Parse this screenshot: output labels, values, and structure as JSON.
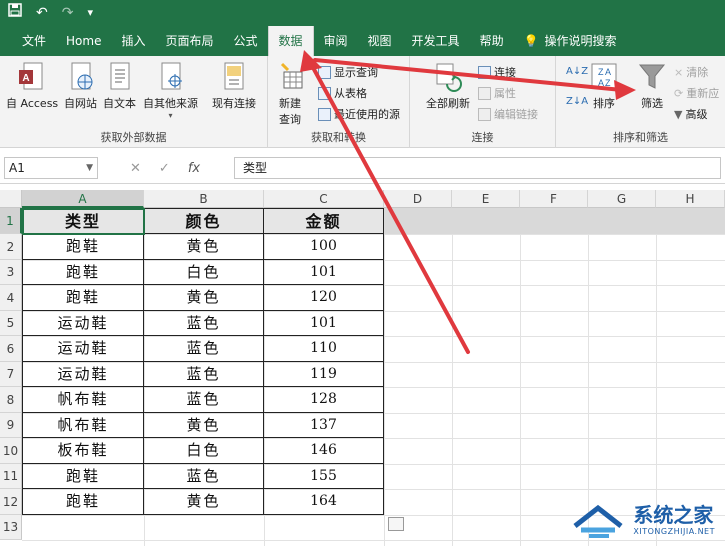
{
  "qat": {
    "undo": "↶",
    "redo": "↷",
    "more": "▾"
  },
  "tabs": [
    {
      "label": "文件"
    },
    {
      "label": "Home"
    },
    {
      "label": "插入"
    },
    {
      "label": "页面布局"
    },
    {
      "label": "公式"
    },
    {
      "label": "数据"
    },
    {
      "label": "审阅"
    },
    {
      "label": "视图"
    },
    {
      "label": "开发工具"
    },
    {
      "label": "帮助"
    },
    {
      "label": "操作说明搜索"
    }
  ],
  "ribbon": {
    "get_external": {
      "label": "获取外部数据",
      "buttons": [
        "自 Access",
        "自网站",
        "自文本",
        "自其他来源",
        "现有连接"
      ]
    },
    "get_transform": {
      "label": "获取和转换",
      "new_query_1": "新建",
      "new_query_2": "查询",
      "show_queries": "显示查询",
      "from_table": "从表格",
      "recent_sources": "最近使用的源"
    },
    "connections": {
      "label": "连接",
      "refresh_all": "全部刷新",
      "connections": "连接",
      "properties": "属性",
      "edit_links": "编辑链接"
    },
    "sort_filter": {
      "label": "排序和筛选",
      "sort": "排序",
      "filter": "筛选",
      "clear": "清除",
      "reapply": "重新应",
      "advanced": "高级"
    }
  },
  "formula_bar": {
    "name_box": "A1",
    "fx": "fx",
    "content": "类型"
  },
  "columns": [
    "A",
    "B",
    "C",
    "D",
    "E",
    "F",
    "G",
    "H"
  ],
  "rows": [
    "1",
    "2",
    "3",
    "4",
    "5",
    "6",
    "7",
    "8",
    "9",
    "10",
    "11",
    "12",
    "13"
  ],
  "table": {
    "headers": [
      "类型",
      "颜色",
      "金额"
    ],
    "data": [
      [
        "跑鞋",
        "黄色",
        "100"
      ],
      [
        "跑鞋",
        "白色",
        "101"
      ],
      [
        "跑鞋",
        "黄色",
        "120"
      ],
      [
        "运动鞋",
        "蓝色",
        "101"
      ],
      [
        "运动鞋",
        "蓝色",
        "110"
      ],
      [
        "运动鞋",
        "蓝色",
        "119"
      ],
      [
        "帆布鞋",
        "蓝色",
        "128"
      ],
      [
        "帆布鞋",
        "黄色",
        "137"
      ],
      [
        "板布鞋",
        "白色",
        "146"
      ],
      [
        "跑鞋",
        "蓝色",
        "155"
      ],
      [
        "跑鞋",
        "黄色",
        "164"
      ]
    ]
  },
  "watermark": {
    "name": "系统之家",
    "url": "XITONGZHIJIA.NET"
  },
  "colors": {
    "accent": "#217346",
    "arrow": "#e0393e"
  }
}
